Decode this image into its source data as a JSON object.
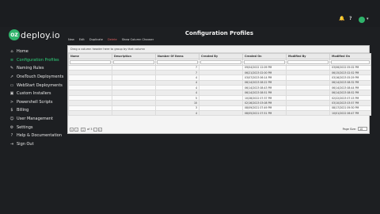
{
  "topbar": {
    "icons": [
      "bell-icon",
      "help-icon",
      "user-avatar",
      "chevron-down-icon"
    ],
    "bell_glyph": "🔔",
    "help_glyph": "?",
    "caret_glyph": "▾"
  },
  "brand": {
    "badge": "OZ",
    "name": "deploy.io",
    "accent": "#2fb36b"
  },
  "sidebar": {
    "items": [
      {
        "label": "Home",
        "icon": "home-icon",
        "glyph": "⌂"
      },
      {
        "label": "Configuration Profiles",
        "icon": "sliders-icon",
        "glyph": "≡",
        "active": true
      },
      {
        "label": "Naming Rules",
        "icon": "tag-icon",
        "glyph": "✎"
      },
      {
        "label": "OneTouch Deployments",
        "icon": "rocket-icon",
        "glyph": "➚"
      },
      {
        "label": "WebStart Deployments",
        "icon": "monitor-icon",
        "glyph": "▭"
      },
      {
        "label": "Custom Installers",
        "icon": "box-icon",
        "glyph": "▣"
      },
      {
        "label": "Powershell Scripts",
        "icon": "terminal-icon",
        "glyph": ">"
      },
      {
        "label": "Billing",
        "icon": "dollar-icon",
        "glyph": "$"
      },
      {
        "label": "User Management",
        "icon": "users-icon",
        "glyph": "☺"
      },
      {
        "label": "Settings",
        "icon": "gear-icon",
        "glyph": "⚙"
      },
      {
        "label": "Help & Documentation",
        "icon": "help-circle-icon",
        "glyph": "?"
      },
      {
        "label": "Sign Out",
        "icon": "sign-out-icon",
        "glyph": "⇥"
      }
    ]
  },
  "page": {
    "title": "Configuration Profiles"
  },
  "toolbar": {
    "new": "New",
    "edit": "Edit",
    "duplicate": "Duplicate",
    "delete": "Delete",
    "chooser": "Show Column Chooser"
  },
  "grid": {
    "group_hint": "Drag a column header here to group by that column",
    "columns": [
      "Name",
      "Description",
      "Number Of Items",
      "Created By",
      "Created On",
      "Modified By",
      "Modified On"
    ],
    "rows": [
      [
        "",
        "",
        "7",
        "",
        "09/04/2022 12:09 PM",
        "",
        "03/06/2022 05:02 PM"
      ],
      [
        "",
        "",
        "7",
        "",
        "06/21/2023 02:00 PM",
        "",
        "06/15/2023 02:52 PM"
      ],
      [
        "",
        "",
        "4",
        "",
        "03/07/2023 06:14 PM",
        "",
        "03/16/2023 05:29 PM"
      ],
      [
        "",
        "",
        "4",
        "",
        "06/14/2023 08:22 PM",
        "",
        "06/14/2023 08:32 PM"
      ],
      [
        "",
        "",
        "4",
        "",
        "06/14/2023 08:43 PM",
        "",
        "06/14/2023 08:44 PM"
      ],
      [
        "",
        "",
        "4",
        "",
        "06/14/2023 08:51 PM",
        "",
        "06/14/2023 08:52 PM"
      ],
      [
        "",
        "",
        "5",
        "",
        "10/28/2022 07:37 PM",
        "",
        "02/22/2023 07:15 PM"
      ],
      [
        "",
        "",
        "10",
        "",
        "02/16/2023 03:08 PM",
        "",
        "03/10/2023 03:57 PM"
      ],
      [
        "",
        "",
        "3",
        "",
        "08/09/2021 07:49 PM",
        "",
        "08/17/2021 09:30 PM"
      ],
      [
        "",
        "",
        "4",
        "",
        "08/05/2021 07:51 PM",
        "",
        "10/01/2022 06:47 PM"
      ]
    ]
  },
  "pager": {
    "current_page": "1",
    "of_label": "of",
    "total_pages": "3",
    "page_size_label": "Page Size:",
    "page_size": "10"
  }
}
